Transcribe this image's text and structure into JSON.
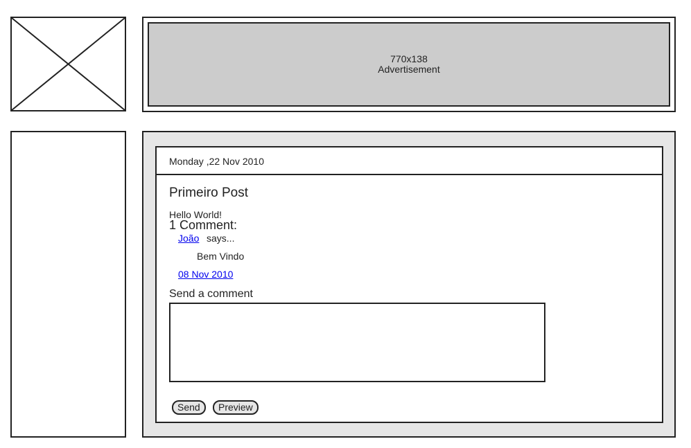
{
  "ad": {
    "size": "770x138",
    "label": "Advertisement"
  },
  "post": {
    "date": "Monday ,22 Nov 2010",
    "title": "Primeiro Post",
    "body": "Hello World!",
    "comments_count": "1 Comment:",
    "comment": {
      "author": "João",
      "says": "says...",
      "text": "Bem Vindo",
      "date": "08 Nov 2010"
    },
    "form": {
      "label": "Send a comment",
      "textarea_value": "",
      "send_label": "Send",
      "preview_label": "Preview"
    }
  },
  "icons": {
    "logo": "image-placeholder-icon"
  },
  "colors": {
    "link": "#0000ee",
    "ad_fill": "#cccccc",
    "main_fill": "#e6e6e6",
    "border": "#222222"
  }
}
